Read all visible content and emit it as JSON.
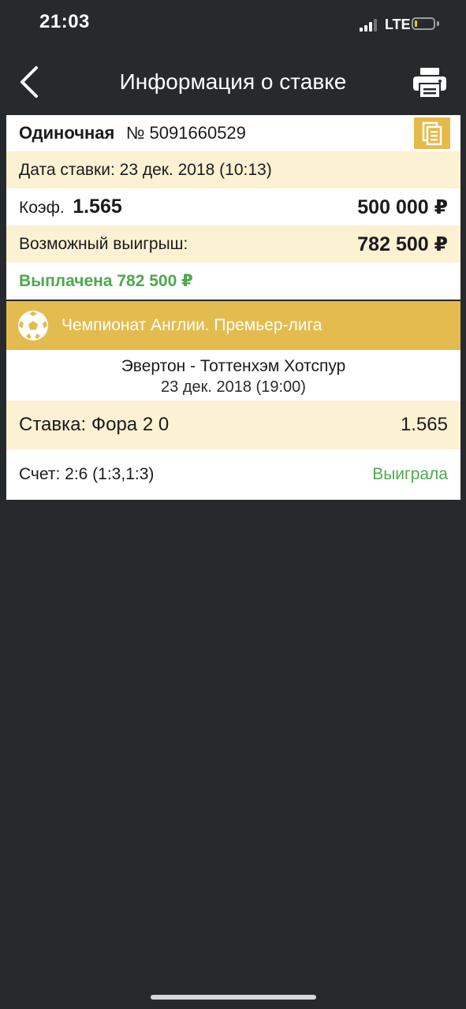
{
  "status_bar": {
    "time": "21:03",
    "network": "LTE",
    "battery_level": 0.15,
    "battery_color": "#f5c518",
    "signal_bars_active": 3
  },
  "header": {
    "title": "Информация о ставке",
    "back_icon": "chevron-left-icon",
    "print_icon": "printer-icon"
  },
  "bet": {
    "type_label": "Одиночная",
    "number": "№ 5091660529",
    "date_text": "Дата ставки: 23 дек. 2018 (10:13)",
    "coef_label": "Коэф.",
    "coef_value": "1.565",
    "stake_amount": "500 000 ₽",
    "potential_label": "Возможный выигрыш:",
    "potential_amount": "782 500 ₽",
    "payout_status": "Выплачена 782 500 ₽",
    "copy_icon": "copy-document-icon"
  },
  "event": {
    "league": "Чемпионат Англии. Премьер-лига",
    "league_icon": "soccer-ball-icon",
    "teams": "Эвертон - Тоттенхэм Хотспур",
    "date": "23 дек. 2018 (19:00)",
    "stake_label": "Ставка: Фора 2 0",
    "stake_coef": "1.565",
    "score": "Счет: 2:6 (1:3,1:3)",
    "result": "Выиграла"
  },
  "colors": {
    "background": "#262a2d",
    "beige_row": "#fdf1d4",
    "league_bar": "#e4bb4f",
    "accent_gold": "#e6b94a",
    "success_green": "#4ea84e"
  }
}
